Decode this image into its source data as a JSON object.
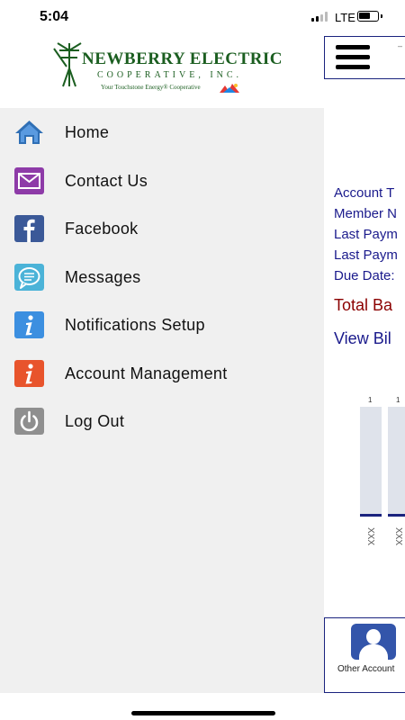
{
  "status_bar": {
    "time": "5:04",
    "network": "LTE"
  },
  "brand": {
    "name_line1": "NEWBERRY ELECTRIC",
    "name_line2": "COOPERATIVE, INC.",
    "tagline": "Your Touchstone Energy® Cooperative",
    "color": "#1b5e20"
  },
  "drawer": {
    "items": [
      {
        "label": "Home",
        "icon": "home-icon",
        "color": "#2f6fb5"
      },
      {
        "label": "Contact Us",
        "icon": "envelope-icon",
        "color": "#8e3ba8"
      },
      {
        "label": "Facebook",
        "icon": "facebook-icon",
        "color": "#3b5998"
      },
      {
        "label": "Messages",
        "icon": "chat-bubble-icon",
        "color": "#4bb3d8"
      },
      {
        "label": "Notifications Setup",
        "icon": "info-icon",
        "color": "#3c8fe0"
      },
      {
        "label": "Account Management",
        "icon": "info-icon",
        "color": "#e8542c"
      },
      {
        "label": "Log Out",
        "icon": "power-icon",
        "color": "#8f8f8f"
      }
    ]
  },
  "background_app": {
    "account_lines": [
      "Account T",
      "Member N",
      "Last Paym",
      "Last Paym",
      "Due Date:"
    ],
    "total_balance": "Total Ba",
    "view_bill": "View Bil",
    "bar_values_label": [
      "1",
      "1"
    ],
    "bar_categories": [
      "XXX",
      "XXX"
    ],
    "other_accounts": "Other Account",
    "accent": "#1a237e"
  }
}
